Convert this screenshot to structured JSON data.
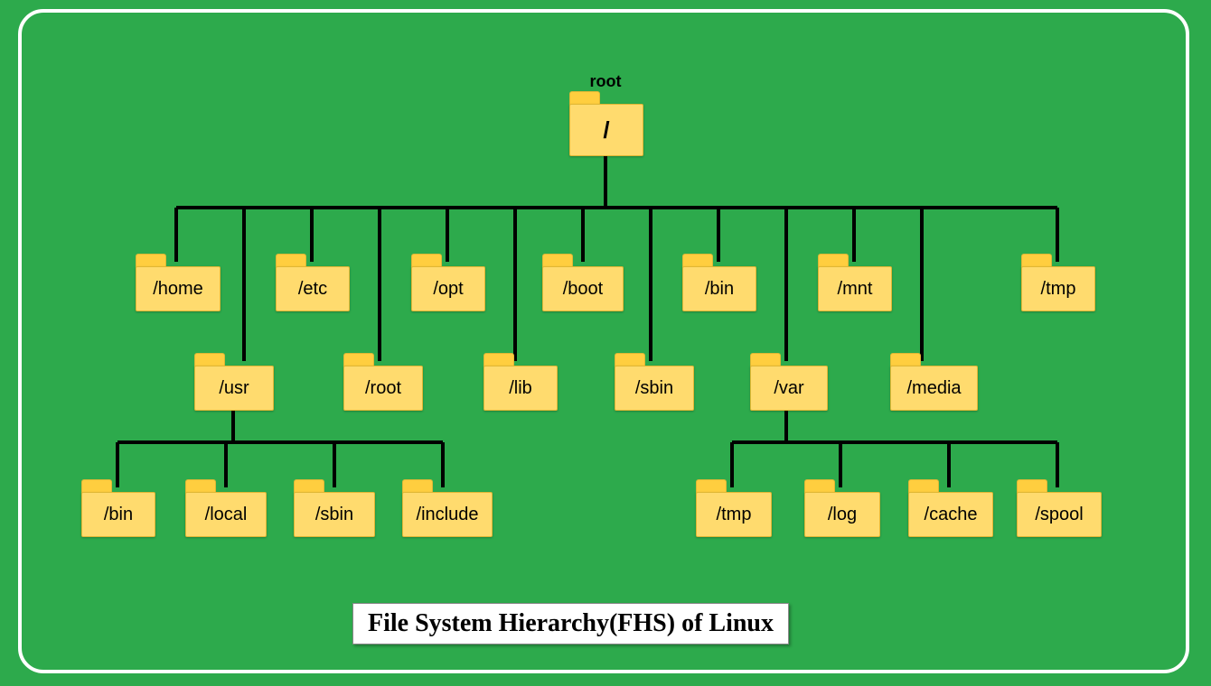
{
  "title": "File System Hierarchy(FHS) of Linux",
  "root": {
    "caption": "root",
    "label": "/"
  },
  "row1": {
    "home": "/home",
    "etc": "/etc",
    "opt": "/opt",
    "boot": "/boot",
    "bin": "/bin",
    "mnt": "/mnt",
    "tmp": "/tmp"
  },
  "row2": {
    "usr": "/usr",
    "root": "/root",
    "lib": "/lib",
    "sbin": "/sbin",
    "var": "/var",
    "media": "/media"
  },
  "usr_children": {
    "bin": "/bin",
    "local": "/local",
    "sbin": "/sbin",
    "include": "/include"
  },
  "var_children": {
    "tmp": "/tmp",
    "log": "/log",
    "cache": "/cache",
    "spool": "/spool"
  }
}
